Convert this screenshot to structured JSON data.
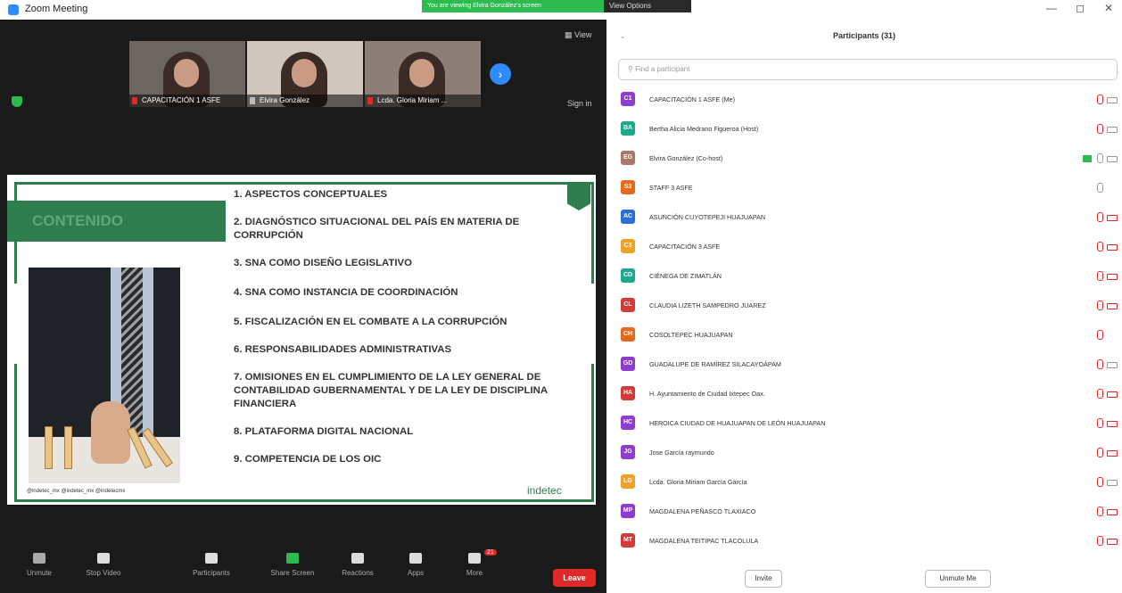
{
  "window": {
    "title": "Zoom Meeting"
  },
  "banner": {
    "text": "You are viewing Elvira González's screen",
    "options": "View Options"
  },
  "thumbnails": [
    {
      "name": "CAPACITACIÓN 1 ASFE",
      "muted": true
    },
    {
      "name": "Elvira González",
      "muted": false
    },
    {
      "name": "Lcda. Gloria Miriam ...",
      "muted": true
    }
  ],
  "meeting": {
    "view_label": "View",
    "signin_label": "Sign in"
  },
  "slide": {
    "section_title": "CONTENIDO",
    "items": [
      "1. ASPECTOS CONCEPTUALES",
      "2. DIAGNÓSTICO SITUACIONAL DEL PAÍS EN MATERIA DE CORRUPCIÓN",
      "3. SNA COMO DISEÑO LEGISLATIVO",
      "4. SNA COMO INSTANCIA DE COORDINACIÓN",
      "5. FISCALIZACIÓN EN EL COMBATE A LA CORRUPCIÓN",
      "6. RESPONSABILIDADES ADMINISTRATIVAS",
      "7. OMISIONES EN EL CUMPLIMIENTO DE LA LEY GENERAL DE CONTABILIDAD GUBERNAMENTAL Y DE LA LEY DE DISCIPLINA FINANCIERA",
      "8. PLATAFORMA DIGITAL NACIONAL",
      "9. COMPETENCIA DE LOS OIC"
    ],
    "social": "@indetec_mx   @indetec_mx   @indetecmx",
    "logo": "indetec"
  },
  "toolbar": {
    "unmute": "Unmute",
    "stop_video": "Stop Video",
    "participants": "Participants",
    "participants_count": "31",
    "share_screen": "Share Screen",
    "reactions": "Reactions",
    "apps": "Apps",
    "more": "More",
    "more_badge": "21",
    "leave": "Leave"
  },
  "panel": {
    "title": "Participants (31)",
    "search_placeholder": "Find a participant",
    "invite": "Invite",
    "unmute_me": "Unmute Me",
    "participants": [
      {
        "initials": "C1",
        "color": "#8e3bd0",
        "name": "CAPACITACIÓN 1 ASFE (Me)",
        "mic": "muted",
        "video": "off-gray"
      },
      {
        "initials": "BA",
        "color": "#1fa88a",
        "name": "Bertha Alicia Medrano Figueroa (Host)",
        "mic": "muted",
        "video": "off-gray"
      },
      {
        "initials": "EG",
        "color": "#a87766",
        "name": "Elvira González (Co-host)",
        "mic": "on",
        "video": "share"
      },
      {
        "initials": "S3",
        "color": "#e8691c",
        "name": "STAFF 3 ASFE",
        "mic": "on",
        "video": "none"
      },
      {
        "initials": "AC",
        "color": "#2b6fd6",
        "name": "ASUNCIÓN CUYOTEPEJI HUAJUAPAN",
        "mic": "muted",
        "video": "off"
      },
      {
        "initials": "C3",
        "color": "#f0a12a",
        "name": "CAPACITACIÓN 3 ASFE",
        "mic": "muted",
        "video": "off"
      },
      {
        "initials": "CD",
        "color": "#1fa88a",
        "name": "CIÉNEGA DE ZIMATLÁN",
        "mic": "muted",
        "video": "off"
      },
      {
        "initials": "CL",
        "color": "#d23a3a",
        "name": "CLAUDIA LIZETH SAMPEDRO JUAREZ",
        "mic": "muted",
        "video": "off"
      },
      {
        "initials": "CH",
        "color": "#e8691c",
        "name": "COSOLTEPEC HUAJUAPAN",
        "mic": "muted",
        "video": "none"
      },
      {
        "initials": "GD",
        "color": "#8e3bd0",
        "name": "GUADALUPE DE RAMÍREZ SILACAYOÁPAM",
        "mic": "muted",
        "video": "off-gray"
      },
      {
        "initials": "HA",
        "color": "#d23a3a",
        "name": "H. Ayuntamiento de Ciudad Ixtepec Oax.",
        "mic": "muted",
        "video": "off"
      },
      {
        "initials": "HC",
        "color": "#8e3bd0",
        "name": "HEROICA CIUDAD DE HUAJUAPAN DE LEÓN HUAJUAPAN",
        "mic": "muted",
        "video": "off"
      },
      {
        "initials": "JG",
        "color": "#8e3bd0",
        "name": "Jose García raymundo",
        "mic": "muted",
        "video": "off"
      },
      {
        "initials": "LG",
        "color": "#f0a12a",
        "name": "Lcda. Gloria Miriam García García",
        "mic": "muted",
        "video": "off-gray"
      },
      {
        "initials": "MP",
        "color": "#8e3bd0",
        "name": "MAGDALENA PEÑASCO TLAXIACO",
        "mic": "muted",
        "video": "off"
      },
      {
        "initials": "MT",
        "color": "#d23a3a",
        "name": "MAGDALENA TEITIPAC TLACOLULA",
        "mic": "muted",
        "video": "off"
      }
    ]
  }
}
